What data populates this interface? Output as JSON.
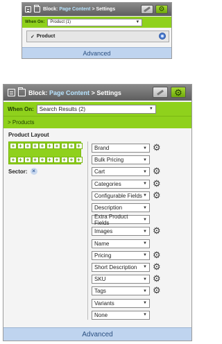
{
  "small_panel": {
    "block_label": "Block:",
    "block_link": "Page Content",
    "settings_suffix": "> Settings",
    "when_on_label": "When On:",
    "when_on_value": "Product (1)",
    "product_row_label": "Product",
    "advanced_label": "Advanced"
  },
  "big_panel": {
    "block_label": "Block:",
    "block_link": "Page Content",
    "settings_suffix": "> Settings",
    "when_on_label": "When On:",
    "when_on_value": "Search Results (2)",
    "products_header": "> Products",
    "product_layout_label": "Product Layout",
    "sector_label": "Sector:",
    "sector_remove_glyph": "×",
    "fields": [
      {
        "value": "Brand",
        "has_gear": true
      },
      {
        "value": "Bulk Pricing",
        "has_gear": false
      },
      {
        "value": "Cart",
        "has_gear": true
      },
      {
        "value": "Categories",
        "has_gear": true
      },
      {
        "value": "Configurable Fields",
        "has_gear": true
      },
      {
        "value": "Description",
        "has_gear": false
      },
      {
        "value": "Extra Product Fields",
        "has_gear": false
      },
      {
        "value": "Images",
        "has_gear": true
      },
      {
        "value": "Name",
        "has_gear": false
      },
      {
        "value": "Pricing",
        "has_gear": true
      },
      {
        "value": "Short Description",
        "has_gear": true
      },
      {
        "value": "SKU",
        "has_gear": true
      },
      {
        "value": "Tags",
        "has_gear": true
      },
      {
        "value": "Variants",
        "has_gear": false
      },
      {
        "value": "None",
        "has_gear": false
      }
    ],
    "advanced_label": "Advanced"
  },
  "colors": {
    "accent_green": "#8fd11c",
    "titlebar_gray": "#6e6e6e",
    "advanced_blue": "#bfd4ef"
  },
  "icons": {
    "plus": "+",
    "check": "✓",
    "caret": "▼",
    "gear": "⚙"
  }
}
